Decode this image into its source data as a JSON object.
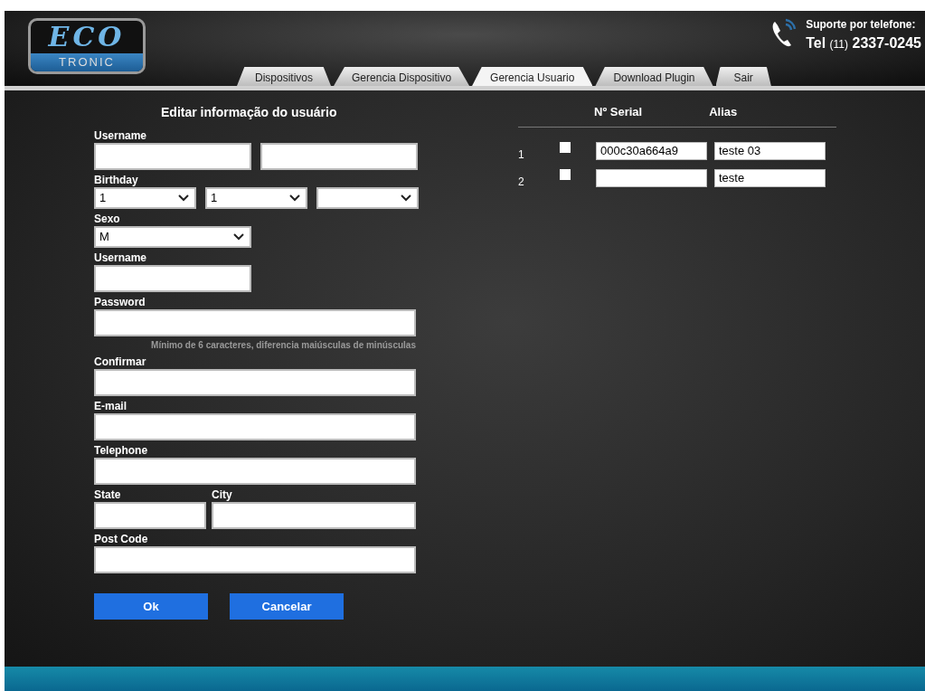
{
  "logo": {
    "top": "ECO",
    "bottom": "TRONIC"
  },
  "support": {
    "label": "Suporte por telefone:",
    "prefix": "Tel",
    "area": "(11)",
    "number": "2337-0245"
  },
  "tabs": [
    {
      "label": "Dispositivos",
      "selected": false
    },
    {
      "label": "Gerencia Dispositivo",
      "selected": false
    },
    {
      "label": "Gerencia Usuario",
      "selected": true
    },
    {
      "label": "Download Plugin",
      "selected": false
    },
    {
      "label": "Sair",
      "selected": false
    }
  ],
  "form": {
    "title": "Editar informação do usuário",
    "rows": [
      {
        "cells": [
          {
            "label": "Username",
            "controls": [
              {
                "kind": "text"
              },
              {
                "kind": "text"
              }
            ]
          }
        ]
      },
      {
        "cells": [
          {
            "label": "Birthday",
            "controls": [
              {
                "kind": "select",
                "value": "1"
              },
              {
                "kind": "select",
                "value": "1"
              },
              {
                "kind": "select"
              }
            ]
          }
        ]
      },
      {
        "cells": [
          {
            "label": "Sexo",
            "controls": [
              {
                "kind": "select",
                "value": "M"
              }
            ]
          }
        ]
      },
      {
        "cells": [
          {
            "label": "Username",
            "controls": [
              {
                "kind": "text"
              }
            ]
          }
        ]
      },
      {
        "cells": [
          {
            "label": "Password",
            "hint": "Mínimo de 6 caracteres, diferencia maiúsculas de minúsculas",
            "controls": [
              {
                "kind": "text"
              }
            ]
          }
        ]
      },
      {
        "cells": [
          {
            "label": "Confirmar",
            "controls": [
              {
                "kind": "text"
              }
            ]
          }
        ]
      },
      {
        "cells": [
          {
            "label": "E-mail",
            "controls": [
              {
                "kind": "text"
              }
            ]
          }
        ]
      },
      {
        "cells": [
          {
            "label": "Telephone",
            "controls": [
              {
                "kind": "text"
              }
            ]
          }
        ]
      },
      {
        "cells": [
          {
            "label": "State",
            "controls": [
              {
                "kind": "text"
              }
            ]
          },
          {
            "label": "City",
            "controls": [
              {
                "kind": "text"
              }
            ]
          }
        ]
      },
      {
        "cells": [
          {
            "label": "Post Code",
            "controls": [
              {
                "kind": "text"
              }
            ]
          }
        ]
      }
    ],
    "buttons": [
      "Ok",
      "Cancelar"
    ]
  },
  "devices": {
    "columns": [
      "Nº Serial",
      "Alias"
    ],
    "rows": [
      {
        "index": "1",
        "checked": false,
        "serial": "000c30a664a9",
        "alias": "teste 03"
      },
      {
        "index": "2",
        "checked": false,
        "alias": "teste"
      }
    ]
  }
}
